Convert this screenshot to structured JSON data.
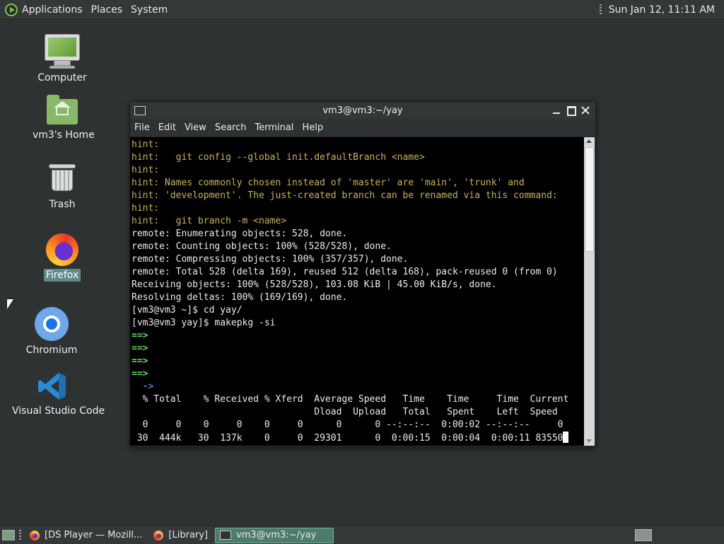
{
  "top_panel": {
    "menus": [
      "Applications",
      "Places",
      "System"
    ],
    "clock": "Sun Jan 12, 11:11 AM"
  },
  "desktop": {
    "icons": [
      {
        "label": "Computer"
      },
      {
        "label": "vm3's Home"
      },
      {
        "label": "Trash"
      },
      {
        "label": "Firefox"
      },
      {
        "label": "Chromium"
      },
      {
        "label": "Visual Studio Code"
      }
    ]
  },
  "terminal": {
    "title": "vm3@vm3:~/yay",
    "menu": [
      "File",
      "Edit",
      "View",
      "Search",
      "Terminal",
      "Help"
    ],
    "lines": [
      {
        "t": "hint:",
        "k": "hint"
      },
      {
        "t": "hint:   git config --global init.defaultBranch <name>",
        "k": "hint"
      },
      {
        "t": "hint:",
        "k": "hint"
      },
      {
        "t": "hint: Names commonly chosen instead of 'master' are 'main', 'trunk' and",
        "k": "hint"
      },
      {
        "t": "hint: 'development'. The just-created branch can be renamed via this command:",
        "k": "hint"
      },
      {
        "t": "hint:",
        "k": "hint"
      },
      {
        "t": "hint:   git branch -m <name>",
        "k": "hint"
      },
      {
        "t": "remote: Enumerating objects: 528, done.",
        "k": "out"
      },
      {
        "t": "remote: Counting objects: 100% (528/528), done.",
        "k": "out"
      },
      {
        "t": "remote: Compressing objects: 100% (357/357), done.",
        "k": "out"
      },
      {
        "t": "remote: Total 528 (delta 169), reused 512 (delta 168), pack-reused 0 (from 0)",
        "k": "out"
      },
      {
        "t": "Receiving objects: 100% (528/528), 103.08 KiB | 45.00 KiB/s, done.",
        "k": "out"
      },
      {
        "t": "Resolving deltas: 100% (169/169), done.",
        "k": "out"
      },
      {
        "t": "[vm3@vm3 ~]$ cd yay/",
        "k": "out"
      },
      {
        "t": "[vm3@vm3 yay]$ makepkg -si",
        "k": "out"
      },
      {
        "t": "==>",
        "k": "arrow"
      },
      {
        "t": "==>",
        "k": "arrow"
      },
      {
        "t": "==>",
        "k": "arrow"
      },
      {
        "t": "==>",
        "k": "arrow"
      },
      {
        "t": "  ->",
        "k": "arrow2"
      },
      {
        "t": "  % Total    % Received % Xferd  Average Speed   Time    Time     Time  Current",
        "k": "out"
      },
      {
        "t": "                                 Dload  Upload   Total   Spent    Left  Speed",
        "k": "out"
      },
      {
        "t": "  0     0    0     0    0     0      0      0 --:--:--  0:00:02 --:--:--     0",
        "k": "out"
      },
      {
        "t": " 30  444k   30  137k    0     0  29301      0  0:00:15  0:00:04  0:00:11 83550",
        "k": "cursor"
      }
    ]
  },
  "taskbar": {
    "tasks": [
      {
        "label": "[DS Player — Mozill...",
        "icon": "firefox-icon"
      },
      {
        "label": "[Library]",
        "icon": "firefox-icon"
      },
      {
        "label": "vm3@vm3:~/yay",
        "icon": "terminal-icon"
      }
    ]
  }
}
